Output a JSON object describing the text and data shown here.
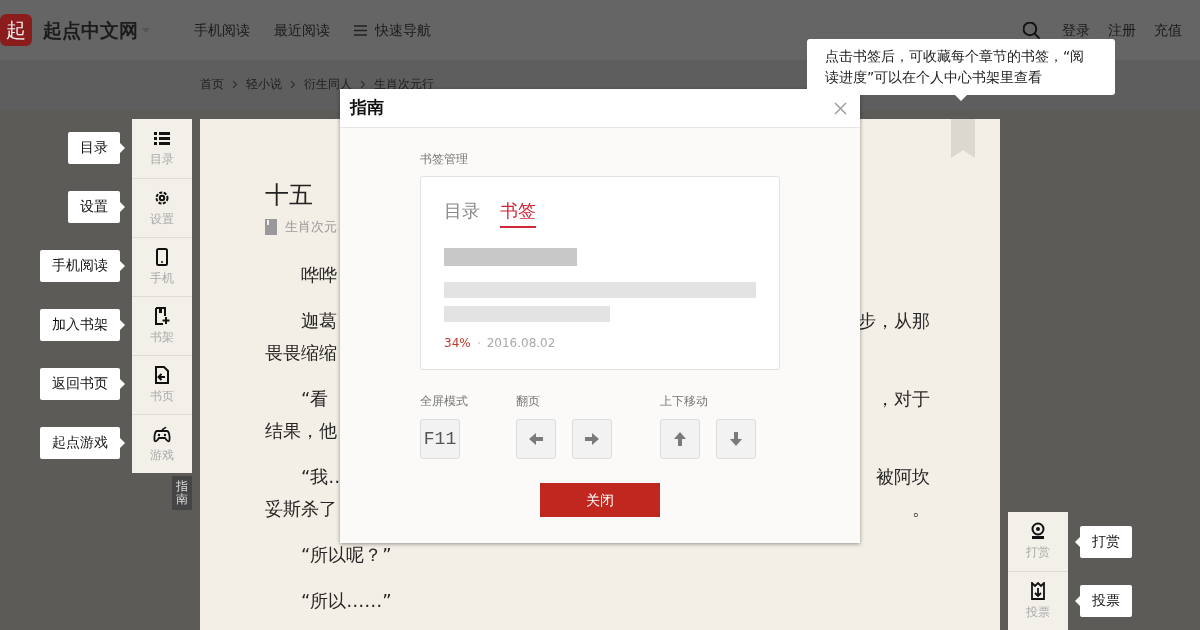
{
  "header": {
    "logo": "起",
    "site_name": "起点中文网",
    "nav": [
      "手机阅读",
      "最近阅读",
      "快速导航"
    ],
    "account_links": [
      "登录",
      "注册",
      "充值"
    ]
  },
  "breadcrumb": [
    "首页",
    "轻小说",
    "衍生同人",
    "生肖次元行"
  ],
  "left_toolbar": [
    {
      "label": "目录",
      "tip": "目录"
    },
    {
      "label": "设置",
      "tip": "设置"
    },
    {
      "label": "手机",
      "tip": "手机阅读"
    },
    {
      "label": "书架",
      "tip": "加入书架"
    },
    {
      "label": "书页",
      "tip": "返回书页"
    },
    {
      "label": "游戏",
      "tip": "起点游戏"
    }
  ],
  "guide_tab": "指南",
  "article": {
    "title": "十五",
    "author": "生肖次元",
    "paragraphs": [
      {
        "lines": [
          {
            "left": "　　哗哗"
          }
        ]
      },
      {
        "lines": [
          {
            "left": "　　迦葛",
            "right": "步，从那"
          },
          {
            "left": "畏畏缩缩"
          }
        ]
      },
      {
        "lines": [
          {
            "left": "　　“看",
            "right": "，对于"
          },
          {
            "left": "结果，他"
          }
        ]
      },
      {
        "lines": [
          {
            "left": "　　“我…",
            "right": "被阿坎"
          },
          {
            "left": "妥斯杀了",
            "right": "。"
          }
        ]
      },
      {
        "lines": [
          {
            "left": "　　“所以呢？”"
          }
        ]
      },
      {
        "lines": [
          {
            "left": "　　“所以……”"
          }
        ]
      }
    ]
  },
  "bookmark_tip": "点击书签后，可收藏每个章节的书签，“阅读进度”可以在个人中心书架里查看",
  "modal": {
    "title": "指南",
    "section_label": "书签管理",
    "tabs": [
      {
        "label": "目录",
        "selected": false
      },
      {
        "label": "书签",
        "selected": true
      }
    ],
    "progress": "34%",
    "date": "2016.08.02",
    "shortcuts": [
      {
        "label": "全屏模式",
        "keys": [
          {
            "kind": "text",
            "text": "F11"
          }
        ]
      },
      {
        "label": "翻页",
        "keys": [
          {
            "kind": "left"
          },
          {
            "kind": "right"
          }
        ]
      },
      {
        "label": "上下移动",
        "keys": [
          {
            "kind": "up"
          },
          {
            "kind": "down"
          }
        ]
      }
    ],
    "close_button": "关闭"
  },
  "right_toolbar": [
    {
      "label": "打赏",
      "tip": "打赏"
    },
    {
      "label": "投票",
      "tip": "投票"
    }
  ]
}
